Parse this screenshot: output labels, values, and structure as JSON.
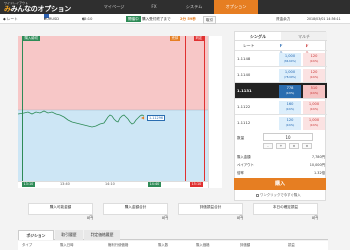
{
  "header": {
    "subtitle": "ワイドレイアウト",
    "brand": "みんなのオプション",
    "nav": [
      "マイページ",
      "FX",
      "システム",
      "オプション"
    ]
  },
  "toolbar": {
    "rate_label": "◆ レート",
    "pair": "EURUSD",
    "period": "15:10",
    "badge": "開催中",
    "countdown_label": "購入受付終了まで",
    "countdown": "2分 59秒",
    "deal_btn": "取引",
    "balance_label": "資金余力",
    "datetime": "2018/03/01  14:36:11"
  },
  "chart": {
    "tag_buy": "購入締切",
    "tag_judge": "判定",
    "tag_sell": "売却",
    "current_price": "1.11296",
    "x_labels": [
      "13:40",
      "14:10",
      "14:40"
    ],
    "start_time": "13:10",
    "end_time": "15:10",
    "now_time": "14:40"
  },
  "panel": {
    "tabs": [
      "シングル",
      "マルチ"
    ],
    "col_rate": "レート",
    "col_up": "ドル高",
    "col_down": "ドル安",
    "rows": [
      {
        "rate": "1.1148",
        "up": "1,000",
        "up_sub": "(84.64%)",
        "down": "120",
        "down_sub": "(0.6%)"
      },
      {
        "rate": "1.1140",
        "up": "1,000",
        "up_sub": "(78.90%)",
        "down": "120",
        "down_sub": "(0.6%)"
      },
      {
        "rate": "1.1131",
        "up": "778",
        "up_sub": "(0.8%)",
        "down": "510",
        "down_sub": "(0.6%)",
        "current": true
      },
      {
        "rate": "1.1122",
        "up": "160",
        "up_sub": "(0.6%)",
        "down": "1,000",
        "down_sub": "(0.6%)"
      },
      {
        "rate": "1.1112",
        "up": "120",
        "up_sub": "(0.6%)",
        "down": "1,000",
        "down_sub": "(0.6%)"
      }
    ],
    "qty_label": "数量",
    "qty_value": "10",
    "step_labels": [
      "-",
      "+",
      "×",
      "×"
    ],
    "kv": [
      {
        "k": "購入金額",
        "v": "7,780円"
      },
      {
        "k": "ペイアウト",
        "v": "10,000円"
      },
      {
        "k": "倍率",
        "v": "1.32倍"
      }
    ],
    "buy_label": "購入",
    "oneclick_label": "ワンクリックで今すぐ購入"
  },
  "summary": [
    {
      "label": "購入可能金額",
      "value": "0円"
    },
    {
      "label": "購入金額合計",
      "value": "0円"
    },
    {
      "label": "評価損益合計",
      "value": "0円"
    },
    {
      "label": "本日の確定損益",
      "value": "0円"
    }
  ],
  "bottom_tabs": [
    "ポジション",
    "取引履歴",
    "判定価格履歴"
  ],
  "table_headers": [
    "タイプ",
    "購入日時",
    "権利行使価格",
    "購入数",
    "購入価格",
    "評価額",
    "損益"
  ]
}
